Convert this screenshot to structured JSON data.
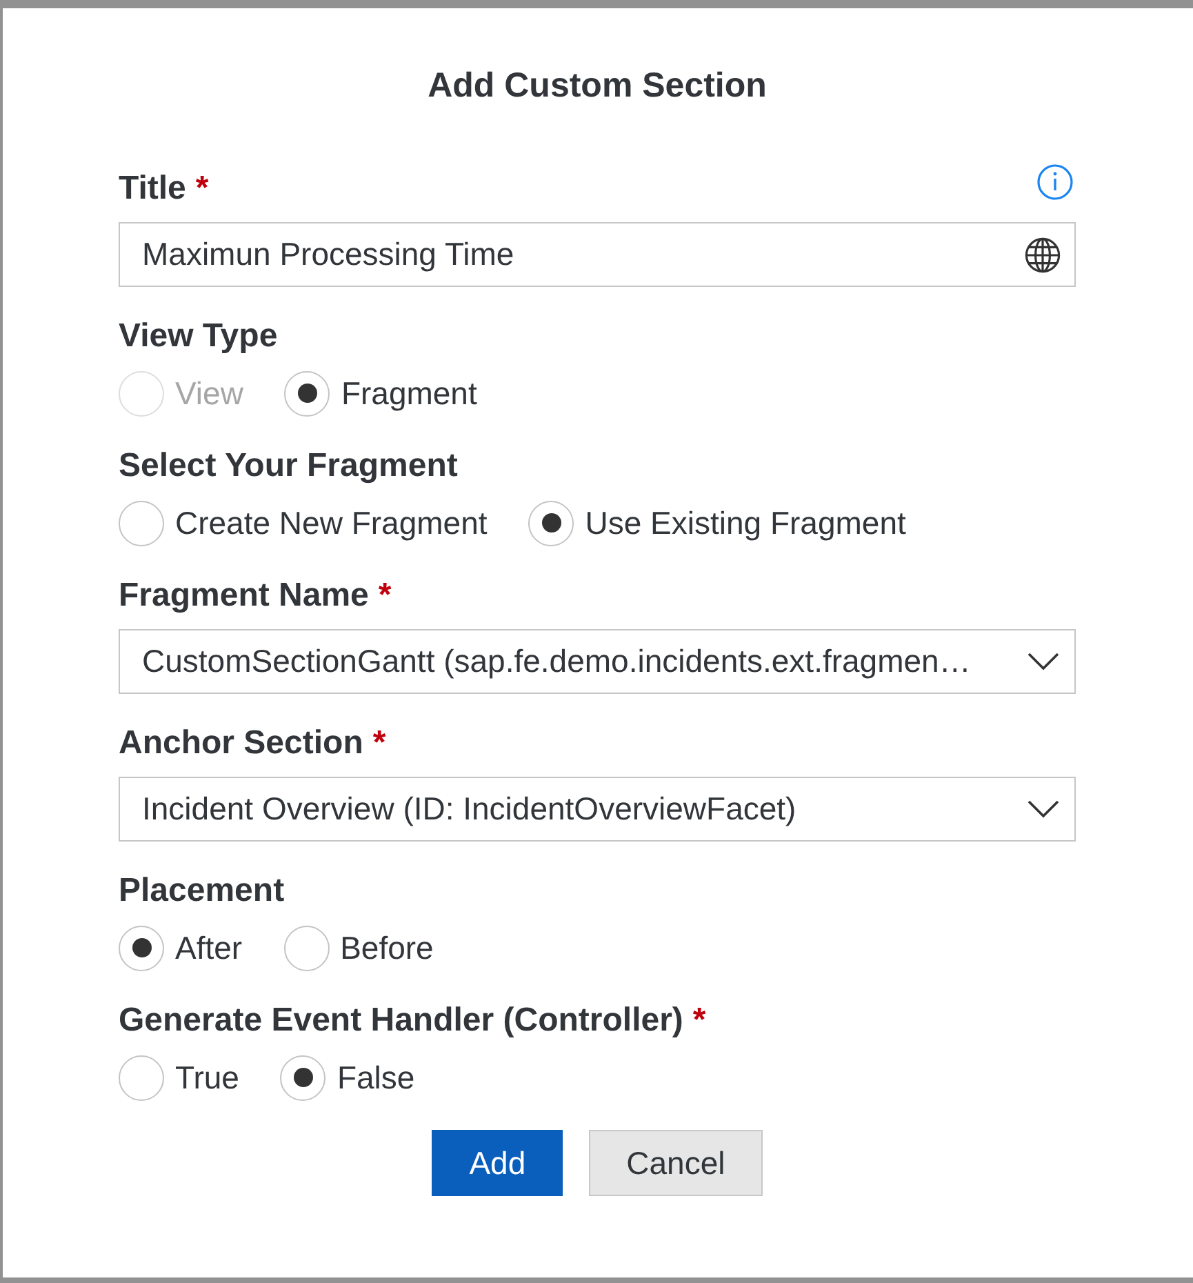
{
  "dialog": {
    "title": "Add Custom Section"
  },
  "fields": [
    {
      "kind": "text",
      "label": "Title",
      "required_mark": "*",
      "value": "Maximun Processing Time"
    },
    {
      "kind": "radio",
      "label": "View Type",
      "options": [
        {
          "label": "View",
          "selected": false,
          "disabled": true
        },
        {
          "label": "Fragment",
          "selected": true,
          "disabled": false
        }
      ]
    },
    {
      "kind": "radio",
      "label": "Select Your Fragment",
      "options": [
        {
          "label": "Create New Fragment",
          "selected": false,
          "disabled": false
        },
        {
          "label": "Use Existing Fragment",
          "selected": true,
          "disabled": false
        }
      ]
    },
    {
      "kind": "select",
      "label": "Fragment Name",
      "required_mark": "*",
      "value": "CustomSectionGantt (sap.fe.demo.incidents.ext.fragmen…"
    },
    {
      "kind": "select",
      "label": "Anchor Section",
      "required_mark": "*",
      "value": "Incident Overview (ID: IncidentOverviewFacet)"
    },
    {
      "kind": "radio",
      "label": "Placement",
      "options": [
        {
          "label": "After",
          "selected": true,
          "disabled": false
        },
        {
          "label": "Before",
          "selected": false,
          "disabled": false
        }
      ]
    },
    {
      "kind": "radio",
      "label": "Generate Event Handler (Controller)",
      "required_mark": "*",
      "options": [
        {
          "label": "True",
          "selected": false,
          "disabled": false
        },
        {
          "label": "False",
          "selected": true,
          "disabled": false
        }
      ]
    }
  ],
  "buttons": [
    {
      "kind": "confirm",
      "label": "Add"
    },
    {
      "kind": "cancel",
      "label": "Cancel"
    }
  ]
}
